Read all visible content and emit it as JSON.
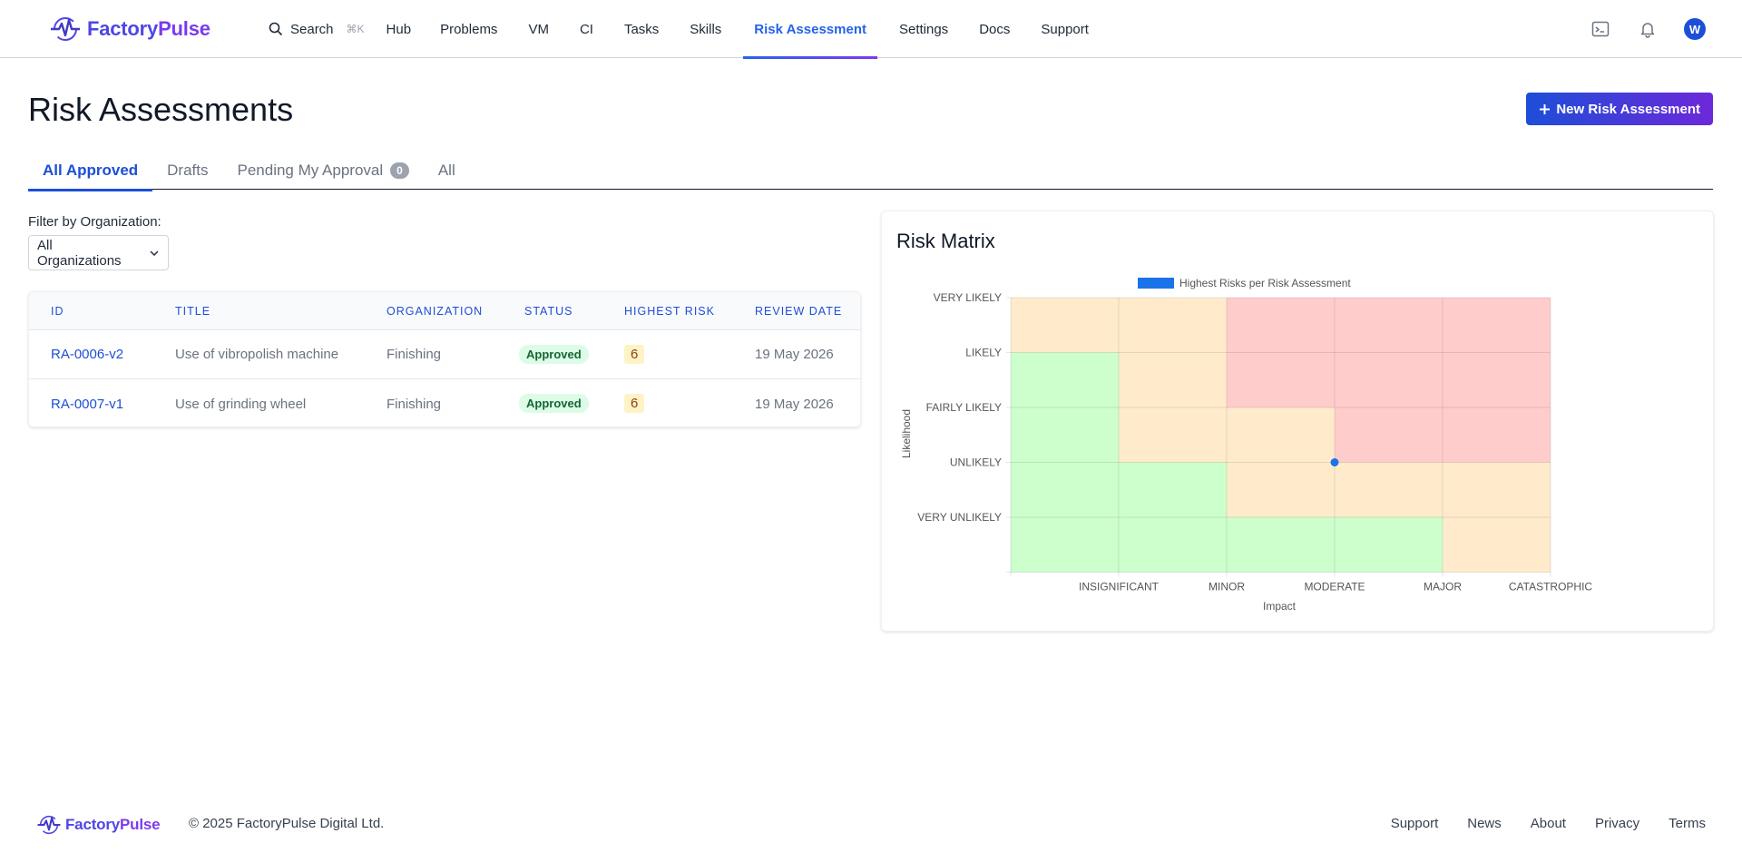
{
  "brand": {
    "name_a": "Factory",
    "name_b": "Pulse"
  },
  "nav": {
    "search_label": "Search",
    "search_shortcut": "⌘K",
    "items": [
      "Hub",
      "Problems",
      "VM",
      "CI",
      "Tasks",
      "Skills",
      "Risk Assessment",
      "Settings",
      "Docs",
      "Support"
    ],
    "active": "Risk Assessment",
    "avatar_initial": "W"
  },
  "header": {
    "title": "Risk Assessments",
    "new_button": "New Risk Assessment"
  },
  "tabs": [
    {
      "label": "All Approved",
      "active": true
    },
    {
      "label": "Drafts"
    },
    {
      "label": "Pending My Approval",
      "badge": "0"
    },
    {
      "label": "All"
    }
  ],
  "filter": {
    "label": "Filter by Organization:",
    "value": "All Organizations"
  },
  "table": {
    "headers": [
      "ID",
      "TITLE",
      "ORGANIZATION",
      "STATUS",
      "HIGHEST RISK",
      "REVIEW DATE"
    ],
    "rows": [
      {
        "id": "RA-0006-v2",
        "title": "Use of vibropolish machine",
        "organization": "Finishing",
        "status": "Approved",
        "highest_risk": "6",
        "review_date": "19 May 2026"
      },
      {
        "id": "RA-0007-v1",
        "title": "Use of grinding wheel",
        "organization": "Finishing",
        "status": "Approved",
        "highest_risk": "6",
        "review_date": "19 May 2026"
      }
    ]
  },
  "matrix": {
    "title": "Risk Matrix",
    "legend": "Highest Risks per Risk Assessment",
    "y_axis_label": "Likelihood",
    "x_axis_label": "Impact",
    "likelihood_levels": [
      "VERY LIKELY",
      "LIKELY",
      "FAIRLY LIKELY",
      "UNLIKELY",
      "VERY UNLIKELY"
    ],
    "impact_levels": [
      "INSIGNIFICANT",
      "MINOR",
      "MODERATE",
      "MAJOR",
      "CATASTROPHIC"
    ],
    "cells": [
      [
        "orange",
        "orange",
        "red",
        "red",
        "red"
      ],
      [
        "green",
        "orange",
        "red",
        "red",
        "red"
      ],
      [
        "green",
        "orange",
        "orange",
        "red",
        "red"
      ],
      [
        "green",
        "green",
        "orange",
        "orange",
        "orange"
      ],
      [
        "green",
        "green",
        "green",
        "green",
        "orange"
      ]
    ],
    "colors": {
      "green": "#ccffcc",
      "orange": "#ffebcc",
      "red": "#ffcccc",
      "point": "#1a73e8"
    },
    "points": [
      {
        "impact": "MODERATE",
        "likelihood": "UNLIKELY"
      }
    ]
  },
  "footer": {
    "copyright": "© 2025 FactoryPulse Digital Ltd.",
    "links": [
      "Support",
      "News",
      "About",
      "Privacy",
      "Terms"
    ]
  }
}
